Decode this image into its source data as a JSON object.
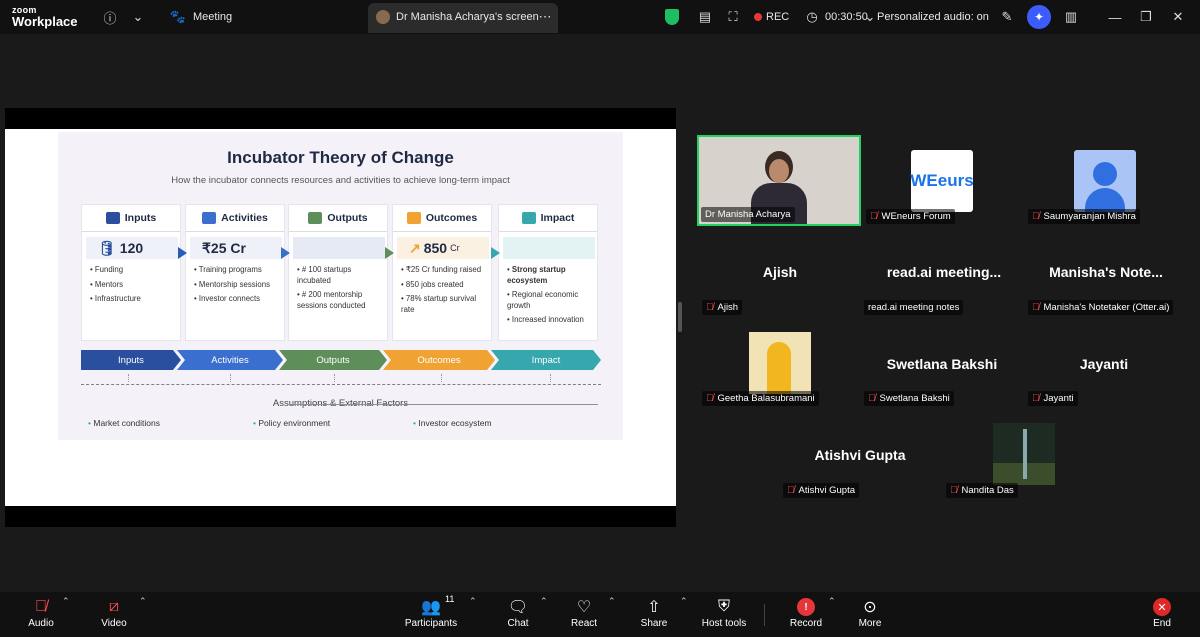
{
  "app": {
    "logo_line1": "zoom",
    "logo_line2": "Workplace"
  },
  "topbar": {
    "meeting_label": "Meeting",
    "share_tab_label": "Dr Manisha Acharya's screen",
    "rec_label": "REC",
    "timer": "00:30:50",
    "audio_label": "Personalized audio: on"
  },
  "slide": {
    "title": "Incubator Theory of Change",
    "subtitle": "How the incubator connects resources and activities to achieve long-term impact",
    "columns": [
      {
        "header": "Inputs",
        "top": "120",
        "items": [
          "Funding",
          "Mentors",
          "Infrastructure"
        ]
      },
      {
        "header": "Activities",
        "top": "₹25 Cr",
        "items": [
          "Training programs",
          "Mentorship sessions",
          "Investor connects"
        ]
      },
      {
        "header": "Outputs",
        "top": "",
        "items": [
          "# 100 startups incubated",
          "# 200 mentorship sessions conducted"
        ]
      },
      {
        "header": "Outcomes",
        "top": "850",
        "top_suffix": "Cr",
        "items": [
          "₹25 Cr funding raised",
          "850 jobs created",
          "78% startup survival rate"
        ]
      },
      {
        "header": "Impact",
        "top": "",
        "items": [
          "Strong startup ecosystem",
          "Regional economic growth",
          "Increased innovation"
        ]
      }
    ],
    "chevrons": [
      "Inputs",
      "Activities",
      "Outputs",
      "Outcomes",
      "Impact"
    ],
    "assumptions_title": "Assumptions & External Factors",
    "factors": [
      "Market conditions",
      "Policy environment",
      "Investor ecosystem"
    ],
    "colors": {
      "inputs": "#2a4f9e",
      "activities": "#3a6fd0",
      "outputs": "#5e8f5a",
      "outcomes": "#f0a233",
      "impact": "#35a7ad"
    }
  },
  "participants": {
    "tiles": [
      {
        "label": "Dr Manisha Acharya",
        "big": ""
      },
      {
        "label": "WEneurs Forum",
        "big": ""
      },
      {
        "label": "Saumyaranjan Mishra",
        "big": ""
      },
      {
        "label": "Ajish",
        "big": "Ajish"
      },
      {
        "label": "read.ai meeting notes",
        "big": "read.ai  meeting..."
      },
      {
        "label": "Manisha's Notetaker (Otter.ai)",
        "big": "Manisha's  Note..."
      },
      {
        "label": "Geetha Balasubramani",
        "big": ""
      },
      {
        "label": "Swetlana Bakshi",
        "big": "Swetlana Bakshi"
      },
      {
        "label": "Jayanti",
        "big": "Jayanti"
      },
      {
        "label": "Atishvi Gupta",
        "big": "Atishvi Gupta"
      },
      {
        "label": "Nandita Das",
        "big": ""
      }
    ],
    "we_logo_text": "WEeurs"
  },
  "bottombar": {
    "audio": "Audio",
    "video": "Video",
    "participants": "Participants",
    "participants_count": "11",
    "chat": "Chat",
    "react": "React",
    "share": "Share",
    "host_tools": "Host tools",
    "record": "Record",
    "more": "More",
    "end": "End"
  }
}
